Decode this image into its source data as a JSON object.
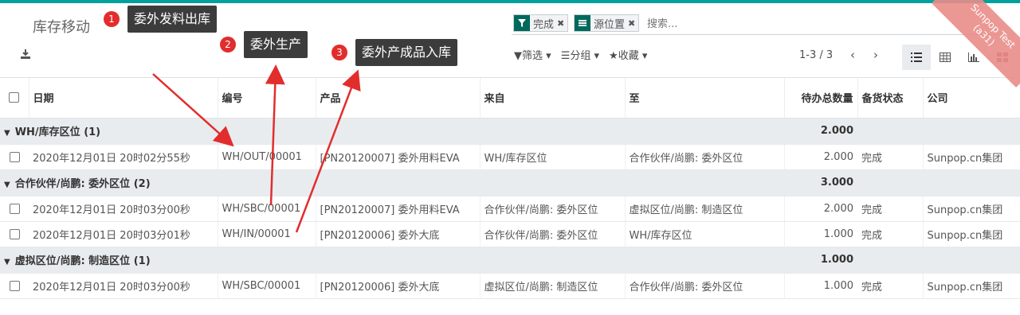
{
  "header": {
    "title": "库存移动",
    "download_icon": "download-icon"
  },
  "search": {
    "facets": [
      {
        "icon": "filter-icon",
        "label": "完成"
      },
      {
        "icon": "groupby-icon",
        "label": "源位置"
      }
    ],
    "placeholder": "搜索..."
  },
  "toolbar": {
    "filter_label": "筛选",
    "group_label": "分组",
    "favorites_label": "收藏",
    "pager": "1-3 / 3",
    "views": [
      "list-view-icon",
      "pivot-view-icon",
      "graph-view-icon",
      "kanban-view-icon"
    ]
  },
  "ribbon": {
    "line1": "Sunpop Test",
    "line2": "(a31)"
  },
  "columns": [
    "日期",
    "编号",
    "产品",
    "来自",
    "至",
    "待办总数量",
    "备货状态",
    "公司"
  ],
  "groups": [
    {
      "label": "WH/库存区位 (1)",
      "total": "2.000",
      "rows": [
        {
          "date": "2020年12月01日 20时02分55秒",
          "ref": "WH/OUT/00001",
          "product": "[PN20120007] 委外用料EVA",
          "from": "WH/库存区位",
          "to": "合作伙伴/尚鹏: 委外区位",
          "qty": "2.000",
          "state": "完成",
          "company": "Sunpop.cn集团"
        }
      ]
    },
    {
      "label": "合作伙伴/尚鹏: 委外区位 (2)",
      "total": "3.000",
      "rows": [
        {
          "date": "2020年12月01日 20时03分00秒",
          "ref": "WH/SBC/00001",
          "product": "[PN20120007] 委外用料EVA",
          "from": "合作伙伴/尚鹏: 委外区位",
          "to": "虚拟区位/尚鹏: 制造区位",
          "qty": "2.000",
          "state": "完成",
          "company": "Sunpop.cn集团"
        },
        {
          "date": "2020年12月01日 20时03分01秒",
          "ref": "WH/IN/00001",
          "product": "[PN20120006] 委外大底",
          "from": "合作伙伴/尚鹏: 委外区位",
          "to": "WH/库存区位",
          "qty": "1.000",
          "state": "完成",
          "company": "Sunpop.cn集团"
        }
      ]
    },
    {
      "label": "虚拟区位/尚鹏: 制造区位 (1)",
      "total": "1.000",
      "rows": [
        {
          "date": "2020年12月01日 20时03分00秒",
          "ref": "WH/SBC/00001",
          "product": "[PN20120006] 委外大底",
          "from": "虚拟区位/尚鹏: 制造区位",
          "to": "合作伙伴/尚鹏: 委外区位",
          "qty": "1.000",
          "state": "完成",
          "company": "Sunpop.cn集团"
        }
      ]
    }
  ],
  "annotations": [
    {
      "num": "1",
      "text": "委外发料出库"
    },
    {
      "num": "2",
      "text": "委外生产"
    },
    {
      "num": "3",
      "text": "委外产成品入库"
    }
  ],
  "colors": {
    "accent": "#00a09d",
    "annotation_red": "#e22d2d",
    "annotation_box": "#3c3c3c"
  }
}
